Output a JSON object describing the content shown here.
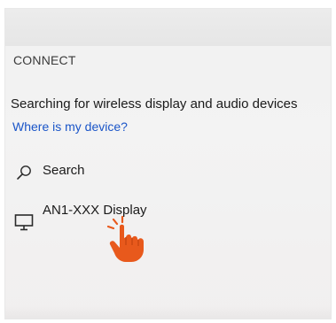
{
  "panel": {
    "title": "CONNECT",
    "status": "Searching for wireless display and audio devices",
    "help_link": "Where is my device?"
  },
  "items": [
    {
      "label": "Search",
      "icon": "search-icon"
    },
    {
      "label": "AN1-XXX Display",
      "icon": "monitor-icon"
    }
  ],
  "overlay": {
    "icon": "pointing-hand-cursor"
  },
  "colors": {
    "panel_bg": "#f2f2f2",
    "topbar_bg": "#e8e8e8",
    "link": "#1a55c8",
    "text": "#1a1a1a",
    "hand": "#e8591c"
  }
}
